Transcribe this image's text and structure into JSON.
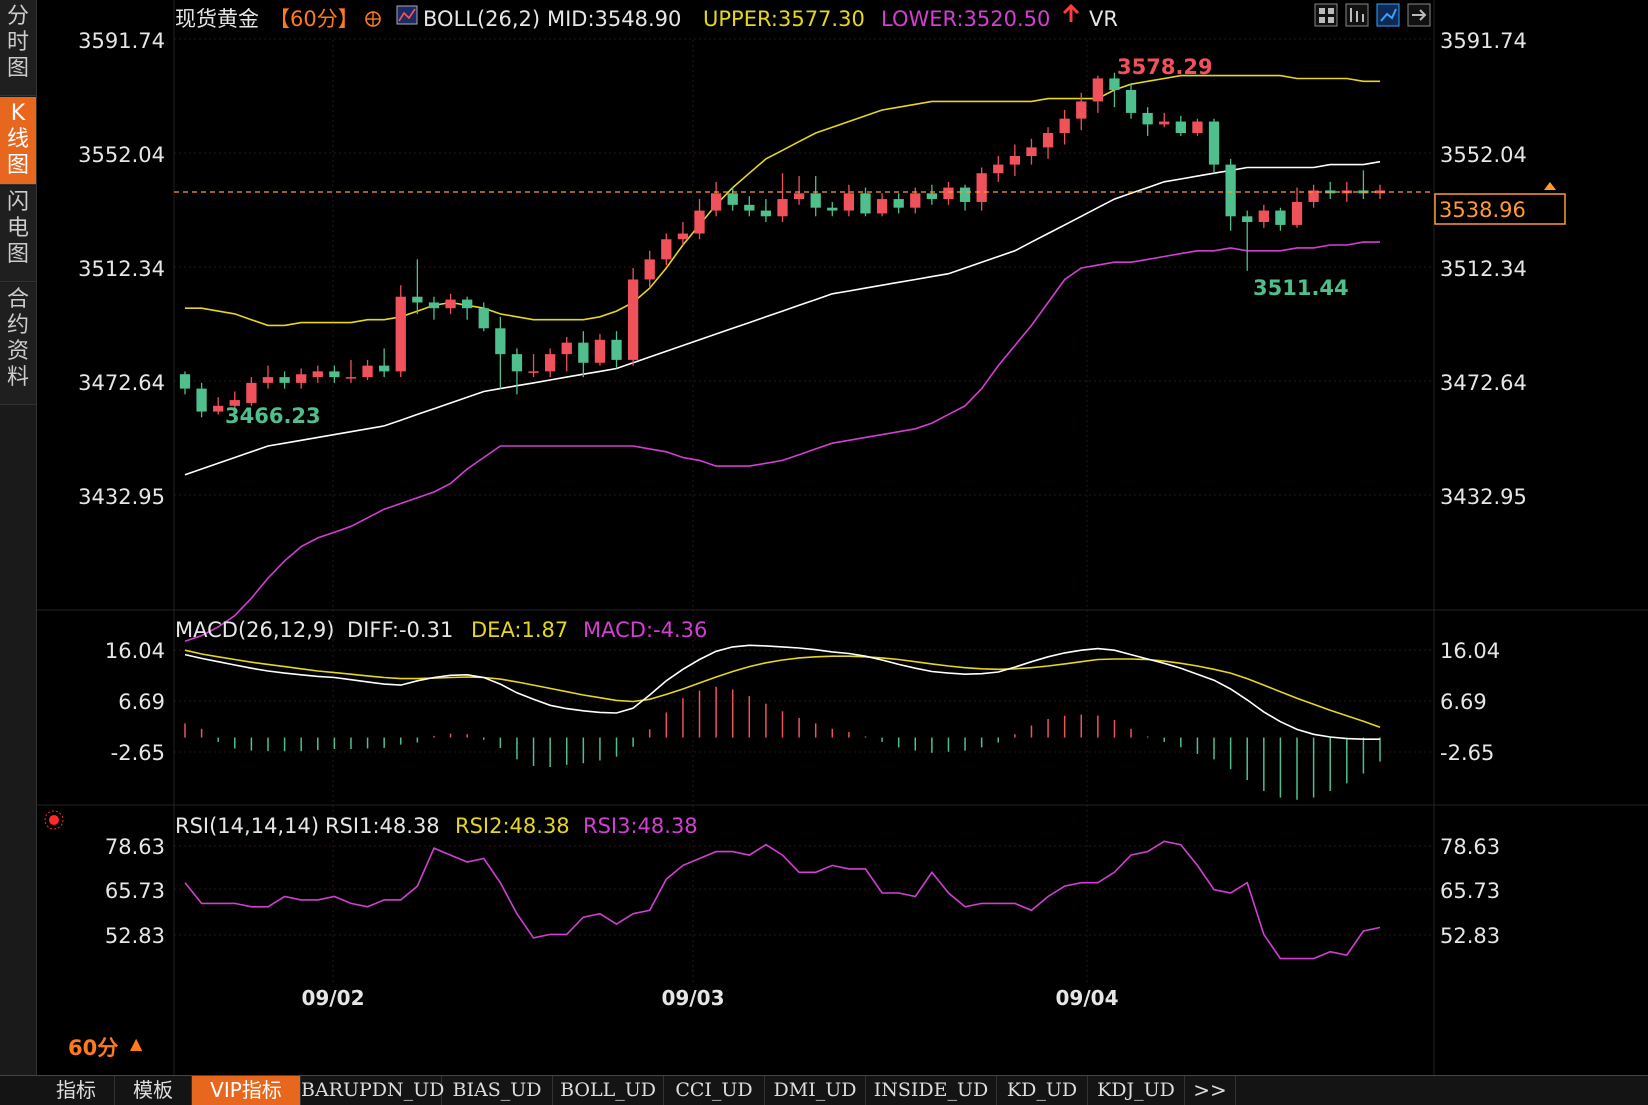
{
  "sidebar": {
    "tabs": [
      {
        "label": "分时图",
        "active": false
      },
      {
        "label": "K线图",
        "active": true
      },
      {
        "label": "闪电图",
        "active": false
      },
      {
        "label": "合约资料",
        "active": false
      }
    ]
  },
  "header": {
    "instrument": "现货黄金",
    "period": "【60分】",
    "boll_label": "BOLL(26,2)",
    "mid_text": "MID:3548.90",
    "upper_text": "UPPER:3577.30",
    "lower_text": "LOWER:3520.50",
    "vr_label": "VR",
    "toolbar_icons": [
      "grid-layout-icon",
      "bar-chart-icon",
      "line-chart-icon",
      "export-icon"
    ]
  },
  "main_axis": {
    "ticks": [
      "3591.74",
      "3552.04",
      "3512.34",
      "3472.64",
      "3432.95"
    ],
    "current_price": "3538.96",
    "high_label": "3578.29",
    "low_label_left": "3466.23",
    "low_label_right": "3511.44"
  },
  "macd": {
    "label": "MACD(26,12,9)",
    "diff_text": "DIFF:-0.31",
    "dea_text": "DEA:1.87",
    "macd_text": "MACD:-4.36",
    "ticks": [
      "16.04",
      "6.69",
      "-2.65"
    ]
  },
  "rsi": {
    "label": "RSI(14,14,14)",
    "rsi1_text": "RSI1:48.38",
    "rsi2_text": "RSI2:48.38",
    "rsi3_text": "RSI3:48.38",
    "ticks": [
      "78.63",
      "65.73",
      "52.83"
    ]
  },
  "xaxis": {
    "dates": [
      "09/02",
      "09/03",
      "09/04"
    ],
    "period_label": "60分"
  },
  "bottom_tabs": [
    "指标",
    "模板",
    "VIP指标",
    "BARUPDN_UD",
    "BIAS_UD",
    "BOLL_UD",
    "CCI_UD",
    "DMI_UD",
    "INSIDE_UD",
    "KD_UD",
    "KDJ_UD",
    ">>"
  ],
  "colors": {
    "up": "#f0525c",
    "down": "#4fc08d",
    "boll_mid": "#ffffff",
    "boll_upper": "#e6d61e",
    "boll_lower": "#d23fd2",
    "accent": "#e8671f",
    "grid": "#2a1212"
  },
  "chart_data": [
    {
      "type": "candlestick",
      "title": "现货黄金【60分】",
      "ylim": [
        3420,
        3598
      ],
      "x_groups": [
        "09/02",
        "09/03",
        "09/04"
      ],
      "candles": [
        [
          3475,
          3470,
          3476,
          3468
        ],
        [
          3470,
          3462,
          3472,
          3460
        ],
        [
          3462,
          3464,
          3467,
          3461
        ],
        [
          3464,
          3466,
          3469,
          3463
        ],
        [
          3465,
          3472,
          3474,
          3464
        ],
        [
          3472,
          3474,
          3478,
          3470
        ],
        [
          3474,
          3472,
          3476,
          3470
        ],
        [
          3472,
          3475,
          3477,
          3470
        ],
        [
          3474,
          3476,
          3478,
          3472
        ],
        [
          3476,
          3474,
          3478,
          3472
        ],
        [
          3474,
          3474,
          3480,
          3472
        ],
        [
          3474,
          3478,
          3480,
          3473
        ],
        [
          3478,
          3476,
          3484,
          3474
        ],
        [
          3476,
          3502,
          3506,
          3474
        ],
        [
          3502,
          3500,
          3515,
          3496
        ],
        [
          3500,
          3498,
          3502,
          3494
        ],
        [
          3498,
          3501,
          3503,
          3496
        ],
        [
          3501,
          3498,
          3502,
          3494
        ],
        [
          3498,
          3491,
          3500,
          3490
        ],
        [
          3491,
          3482,
          3495,
          3470
        ],
        [
          3482,
          3476,
          3484,
          3468
        ],
        [
          3476,
          3476,
          3482,
          3474
        ],
        [
          3476,
          3482,
          3484,
          3474
        ],
        [
          3482,
          3486,
          3488,
          3476
        ],
        [
          3486,
          3479,
          3490,
          3474
        ],
        [
          3479,
          3487,
          3489,
          3478
        ],
        [
          3487,
          3480,
          3490,
          3477
        ],
        [
          3480,
          3508,
          3512,
          3478
        ],
        [
          3508,
          3515,
          3518,
          3505
        ],
        [
          3515,
          3522,
          3524,
          3513
        ],
        [
          3522,
          3524,
          3528,
          3520
        ],
        [
          3524,
          3532,
          3536,
          3522
        ],
        [
          3532,
          3538,
          3542,
          3530
        ],
        [
          3538,
          3534,
          3540,
          3532
        ],
        [
          3534,
          3532,
          3537,
          3530
        ],
        [
          3532,
          3530,
          3536,
          3528
        ],
        [
          3530,
          3536,
          3545,
          3528
        ],
        [
          3536,
          3538,
          3544,
          3534
        ],
        [
          3538,
          3533,
          3544,
          3530
        ],
        [
          3533,
          3532,
          3535,
          3530
        ],
        [
          3532,
          3538,
          3541,
          3530
        ],
        [
          3538,
          3531,
          3540,
          3530
        ],
        [
          3531,
          3536,
          3538,
          3530
        ],
        [
          3536,
          3533,
          3538,
          3531
        ],
        [
          3533,
          3538,
          3540,
          3531
        ],
        [
          3538,
          3536,
          3541,
          3534
        ],
        [
          3536,
          3540,
          3542,
          3534
        ],
        [
          3540,
          3535,
          3541,
          3532
        ],
        [
          3535,
          3545,
          3547,
          3532
        ],
        [
          3545,
          3548,
          3551,
          3542
        ],
        [
          3548,
          3551,
          3555,
          3544
        ],
        [
          3551,
          3554,
          3557,
          3548
        ],
        [
          3554,
          3559,
          3561,
          3550
        ],
        [
          3559,
          3564,
          3567,
          3555
        ],
        [
          3564,
          3570,
          3573,
          3560
        ],
        [
          3570,
          3578,
          3579,
          3566
        ],
        [
          3578,
          3574,
          3580,
          3568
        ],
        [
          3574,
          3566,
          3576,
          3564
        ],
        [
          3566,
          3562,
          3568,
          3558
        ],
        [
          3562,
          3563,
          3566,
          3561
        ],
        [
          3563,
          3559,
          3565,
          3558
        ],
        [
          3559,
          3563,
          3564,
          3558
        ],
        [
          3563,
          3548,
          3564,
          3545
        ],
        [
          3548,
          3530,
          3550,
          3525
        ],
        [
          3530,
          3528,
          3532,
          3511
        ],
        [
          3528,
          3532,
          3534,
          3526
        ],
        [
          3532,
          3527,
          3533,
          3525
        ],
        [
          3527,
          3535,
          3540,
          3526
        ],
        [
          3535,
          3539,
          3541,
          3533
        ],
        [
          3539,
          3538,
          3542,
          3536
        ],
        [
          3538,
          3539,
          3542,
          3535
        ],
        [
          3539,
          3538,
          3546,
          3536
        ],
        [
          3538,
          3539,
          3541,
          3536
        ]
      ],
      "boll_upper": [
        3498,
        3498,
        3497,
        3496,
        3494,
        3492,
        3492,
        3493,
        3493,
        3493,
        3493,
        3494,
        3494,
        3495,
        3497,
        3499,
        3500,
        3499,
        3498,
        3496,
        3495,
        3494,
        3494,
        3494,
        3494,
        3495,
        3497,
        3500,
        3505,
        3512,
        3520,
        3527,
        3534,
        3540,
        3545,
        3550,
        3553,
        3556,
        3559,
        3561,
        3563,
        3565,
        3567,
        3568,
        3569,
        3570,
        3570,
        3570,
        3570,
        3570,
        3570,
        3570,
        3571,
        3571,
        3571,
        3571,
        3574,
        3576,
        3577,
        3578,
        3579,
        3579,
        3579,
        3579,
        3579,
        3579,
        3579,
        3578,
        3578,
        3578,
        3578,
        3577,
        3577
      ],
      "boll_mid": [
        3440,
        3442,
        3444,
        3446,
        3448,
        3450,
        3451,
        3452,
        3453,
        3454,
        3455,
        3456,
        3457,
        3459,
        3461,
        3463,
        3465,
        3467,
        3469,
        3470,
        3471,
        3472,
        3473,
        3474,
        3475,
        3476,
        3477,
        3479,
        3481,
        3483,
        3485,
        3487,
        3489,
        3491,
        3493,
        3495,
        3497,
        3499,
        3501,
        3503,
        3504,
        3505,
        3506,
        3507,
        3508,
        3509,
        3510,
        3512,
        3514,
        3516,
        3518,
        3521,
        3524,
        3527,
        3530,
        3533,
        3536,
        3538,
        3540,
        3542,
        3543,
        3544,
        3545,
        3546,
        3547,
        3547,
        3547,
        3547,
        3547,
        3548,
        3548,
        3548,
        3549
      ],
      "boll_lower": [
        3382,
        3384,
        3387,
        3391,
        3397,
        3404,
        3410,
        3415,
        3418,
        3420,
        3422,
        3425,
        3428,
        3430,
        3432,
        3434,
        3437,
        3442,
        3446,
        3450,
        3450,
        3450,
        3450,
        3450,
        3450,
        3450,
        3450,
        3450,
        3449,
        3448,
        3446,
        3445,
        3443,
        3443,
        3443,
        3444,
        3445,
        3447,
        3449,
        3451,
        3452,
        3453,
        3454,
        3455,
        3456,
        3458,
        3461,
        3464,
        3470,
        3478,
        3485,
        3492,
        3500,
        3508,
        3512,
        3513,
        3514,
        3514,
        3515,
        3516,
        3517,
        3518,
        3518,
        3519,
        3518,
        3518,
        3518,
        3519,
        3519,
        3520,
        3520,
        3521,
        3521
      ]
    },
    {
      "type": "line+bar",
      "title": "MACD(26,12,9)",
      "ylim": [
        -11,
        19
      ],
      "diff": [
        15.2,
        14.5,
        13.9,
        13.3,
        12.7,
        12.2,
        11.8,
        11.5,
        11.2,
        11.0,
        10.6,
        10.2,
        9.8,
        9.6,
        10.4,
        11.0,
        11.4,
        11.5,
        11.0,
        9.8,
        8.2,
        7.0,
        5.9,
        5.3,
        4.9,
        4.6,
        4.5,
        5.4,
        7.8,
        10.4,
        12.5,
        14.3,
        15.8,
        16.6,
        16.9,
        16.8,
        16.6,
        16.4,
        16.1,
        15.7,
        15.4,
        14.9,
        14.2,
        13.4,
        12.7,
        12.1,
        11.8,
        11.6,
        11.7,
        12.0,
        12.9,
        13.9,
        14.8,
        15.5,
        16.0,
        16.3,
        16.0,
        15.2,
        14.4,
        13.6,
        12.7,
        11.6,
        10.5,
        8.9,
        6.9,
        4.7,
        2.9,
        1.5,
        0.6,
        0.1,
        -0.2,
        -0.3,
        -0.3
      ],
      "dea": [
        16.0,
        15.3,
        14.8,
        14.3,
        13.8,
        13.4,
        13.0,
        12.6,
        12.2,
        11.9,
        11.6,
        11.3,
        11.0,
        10.8,
        10.8,
        10.9,
        11.0,
        11.1,
        11.0,
        10.7,
        10.2,
        9.6,
        9.0,
        8.4,
        7.8,
        7.3,
        6.8,
        6.6,
        7.0,
        7.9,
        8.9,
        10.0,
        11.1,
        12.1,
        13.0,
        13.7,
        14.2,
        14.6,
        14.8,
        14.9,
        14.9,
        14.8,
        14.6,
        14.3,
        13.9,
        13.5,
        13.1,
        12.8,
        12.6,
        12.5,
        12.6,
        12.8,
        13.1,
        13.5,
        13.9,
        14.3,
        14.4,
        14.4,
        14.3,
        14.0,
        13.6,
        13.1,
        12.5,
        11.8,
        10.8,
        9.6,
        8.4,
        7.2,
        6.1,
        5.0,
        4.0,
        3.0,
        1.9
      ],
      "macd": [
        2.6,
        1.6,
        -0.8,
        -2.0,
        -2.4,
        -2.5,
        -2.5,
        -2.5,
        -2.3,
        -2.1,
        -2.1,
        -2.0,
        -1.9,
        -1.3,
        -0.9,
        0.3,
        0.7,
        0.6,
        -0.4,
        -1.9,
        -4.0,
        -5.2,
        -5.4,
        -5.0,
        -4.7,
        -4.2,
        -3.5,
        -1.7,
        1.5,
        4.6,
        7.2,
        8.6,
        9.3,
        8.8,
        7.6,
        6.2,
        4.8,
        3.6,
        2.6,
        1.6,
        1.0,
        0.2,
        -0.8,
        -1.8,
        -2.4,
        -2.8,
        -2.6,
        -2.4,
        -1.8,
        -0.9,
        0.6,
        2.2,
        3.4,
        4.0,
        4.2,
        4.0,
        3.2,
        1.6,
        0.2,
        -0.8,
        -1.8,
        -3.0,
        -4.0,
        -5.8,
        -7.8,
        -9.8,
        -11.0,
        -11.4,
        -11.0,
        -9.8,
        -8.4,
        -6.6,
        -4.4
      ]
    },
    {
      "type": "line",
      "title": "RSI(14,14,14)",
      "ylim": [
        40,
        82
      ],
      "rsi1": [
        68,
        62,
        62,
        62,
        61,
        61,
        64,
        63,
        63,
        64,
        62,
        61,
        63,
        63,
        67,
        78,
        76,
        74,
        75,
        68,
        59,
        52,
        53,
        53,
        58,
        59,
        56,
        59,
        60,
        69,
        73,
        75,
        77,
        77,
        76,
        79,
        76,
        71,
        71,
        73,
        72,
        72,
        65,
        65,
        64,
        71,
        65,
        61,
        62,
        62,
        62,
        60,
        64,
        67,
        68,
        68,
        71,
        76,
        77,
        80,
        79,
        73,
        66,
        65,
        68,
        53,
        46,
        46,
        46,
        48,
        47,
        54,
        55
      ]
    }
  ]
}
